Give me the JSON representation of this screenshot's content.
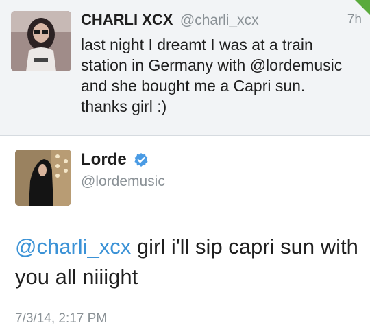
{
  "parent_tweet": {
    "name": "CHARLI XCX",
    "handle": "@charli_xcx",
    "time": "7h",
    "text": "last night I dreamt I was at a train station in Germany with @lordemusic and she bought me a Capri sun. thanks girl :)",
    "avatar_icon": "user-avatar-photo"
  },
  "reply_tweet": {
    "name": "Lorde",
    "verified_icon": "verified-badge-icon",
    "handle": "@lordemusic",
    "mention": "@charli_xcx",
    "text": " girl i'll sip capri sun with you all niiight",
    "timestamp": "7/3/14, 2:17 PM",
    "avatar_icon": "user-avatar-photo"
  },
  "colors": {
    "link_blue": "#3b92d6",
    "muted_gray": "#8a9196",
    "header_bg": "#f2f4f6",
    "badge_green": "#5aaa3c",
    "verified_blue": "#4a9be4"
  }
}
